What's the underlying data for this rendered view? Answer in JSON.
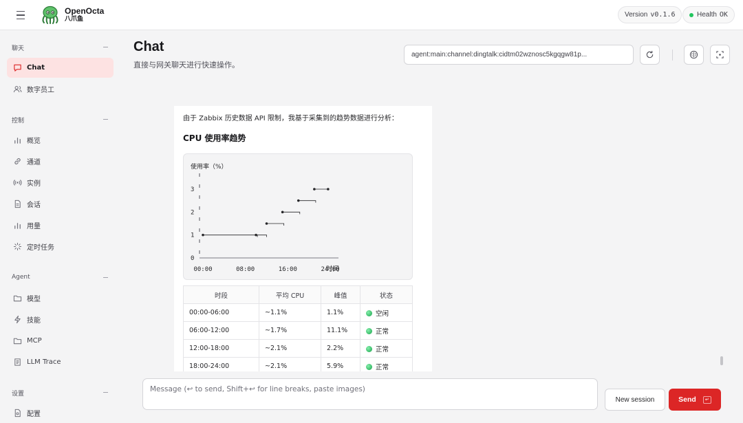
{
  "app": {
    "brand_name": "OpenOcta",
    "brand_sub": "八爪鱼",
    "version_label": "Version",
    "version_value": "v0.1.6",
    "health_label": "Health",
    "health_value": "OK"
  },
  "sidebar": {
    "groups": [
      {
        "title": "聊天",
        "items": [
          {
            "label": "Chat",
            "icon": "chat-bubble-icon",
            "active": true
          },
          {
            "label": "数字员工",
            "icon": "users-icon"
          }
        ]
      },
      {
        "title": "控制",
        "items": [
          {
            "label": "概览",
            "icon": "bar-chart-icon"
          },
          {
            "label": "通道",
            "icon": "link-icon"
          },
          {
            "label": "实例",
            "icon": "radio-icon"
          },
          {
            "label": "会话",
            "icon": "document-icon"
          },
          {
            "label": "用量",
            "icon": "bar-chart-icon"
          },
          {
            "label": "定时任务",
            "icon": "loader-icon"
          }
        ]
      },
      {
        "title": "Agent",
        "items": [
          {
            "label": "模型",
            "icon": "folder-icon"
          },
          {
            "label": "技能",
            "icon": "zap-icon"
          },
          {
            "label": "MCP",
            "icon": "folder-icon"
          },
          {
            "label": "LLM Trace",
            "icon": "scroll-icon"
          }
        ]
      },
      {
        "title": "设置",
        "items": [
          {
            "label": "配置",
            "icon": "settings-icon"
          }
        ]
      }
    ]
  },
  "main": {
    "title": "Chat",
    "subtitle": "直接与网关聊天进行快速操作。",
    "session_key": "agent:main:channel:dingtalk:cidtm02wznosc5kgqgw81p..."
  },
  "message": {
    "intro": "由于 Zabbix 历史数据 API 限制，我基于采集到的趋势数据进行分析：",
    "heading": "CPU 使用率趋势",
    "chart_ylabel": "使用率（%）",
    "chart_x_title": "时间"
  },
  "chart_data": {
    "type": "line",
    "title": "",
    "ylabel": "使用率（%）",
    "xlabel": "时间",
    "x_ticks": [
      "00:00",
      "08:00",
      "16:00",
      "24:00"
    ],
    "y_ticks": [
      "0",
      "1",
      "2",
      "3"
    ],
    "ylim": [
      0,
      3
    ],
    "xlim": [
      0,
      24
    ],
    "series": [
      {
        "x": [
          0,
          10,
          12,
          15,
          18,
          21
        ],
        "y": [
          1,
          1,
          1.5,
          2,
          2.5,
          3
        ]
      }
    ]
  },
  "table": {
    "headers": [
      "时段",
      "平均 CPU",
      "峰值",
      "状态"
    ],
    "rows": [
      [
        "00:00-06:00",
        "~1.1%",
        "1.1%",
        "空闲"
      ],
      [
        "06:00-12:00",
        "~1.7%",
        "11.1%",
        "正常"
      ],
      [
        "12:00-18:00",
        "~2.1%",
        "2.2%",
        "正常"
      ],
      [
        "18:00-24:00",
        "~2.1%",
        "5.9%",
        "正常"
      ]
    ]
  },
  "composer": {
    "placeholder": "Message (↩ to send, Shift+↩ for line breaks, paste images)",
    "new_session_label": "New session",
    "send_label": "Send",
    "send_key": "↵"
  },
  "colors": {
    "accent": "#dc2626",
    "active_nav_bg": "#fde2e2",
    "health_dot": "#22c55e"
  }
}
